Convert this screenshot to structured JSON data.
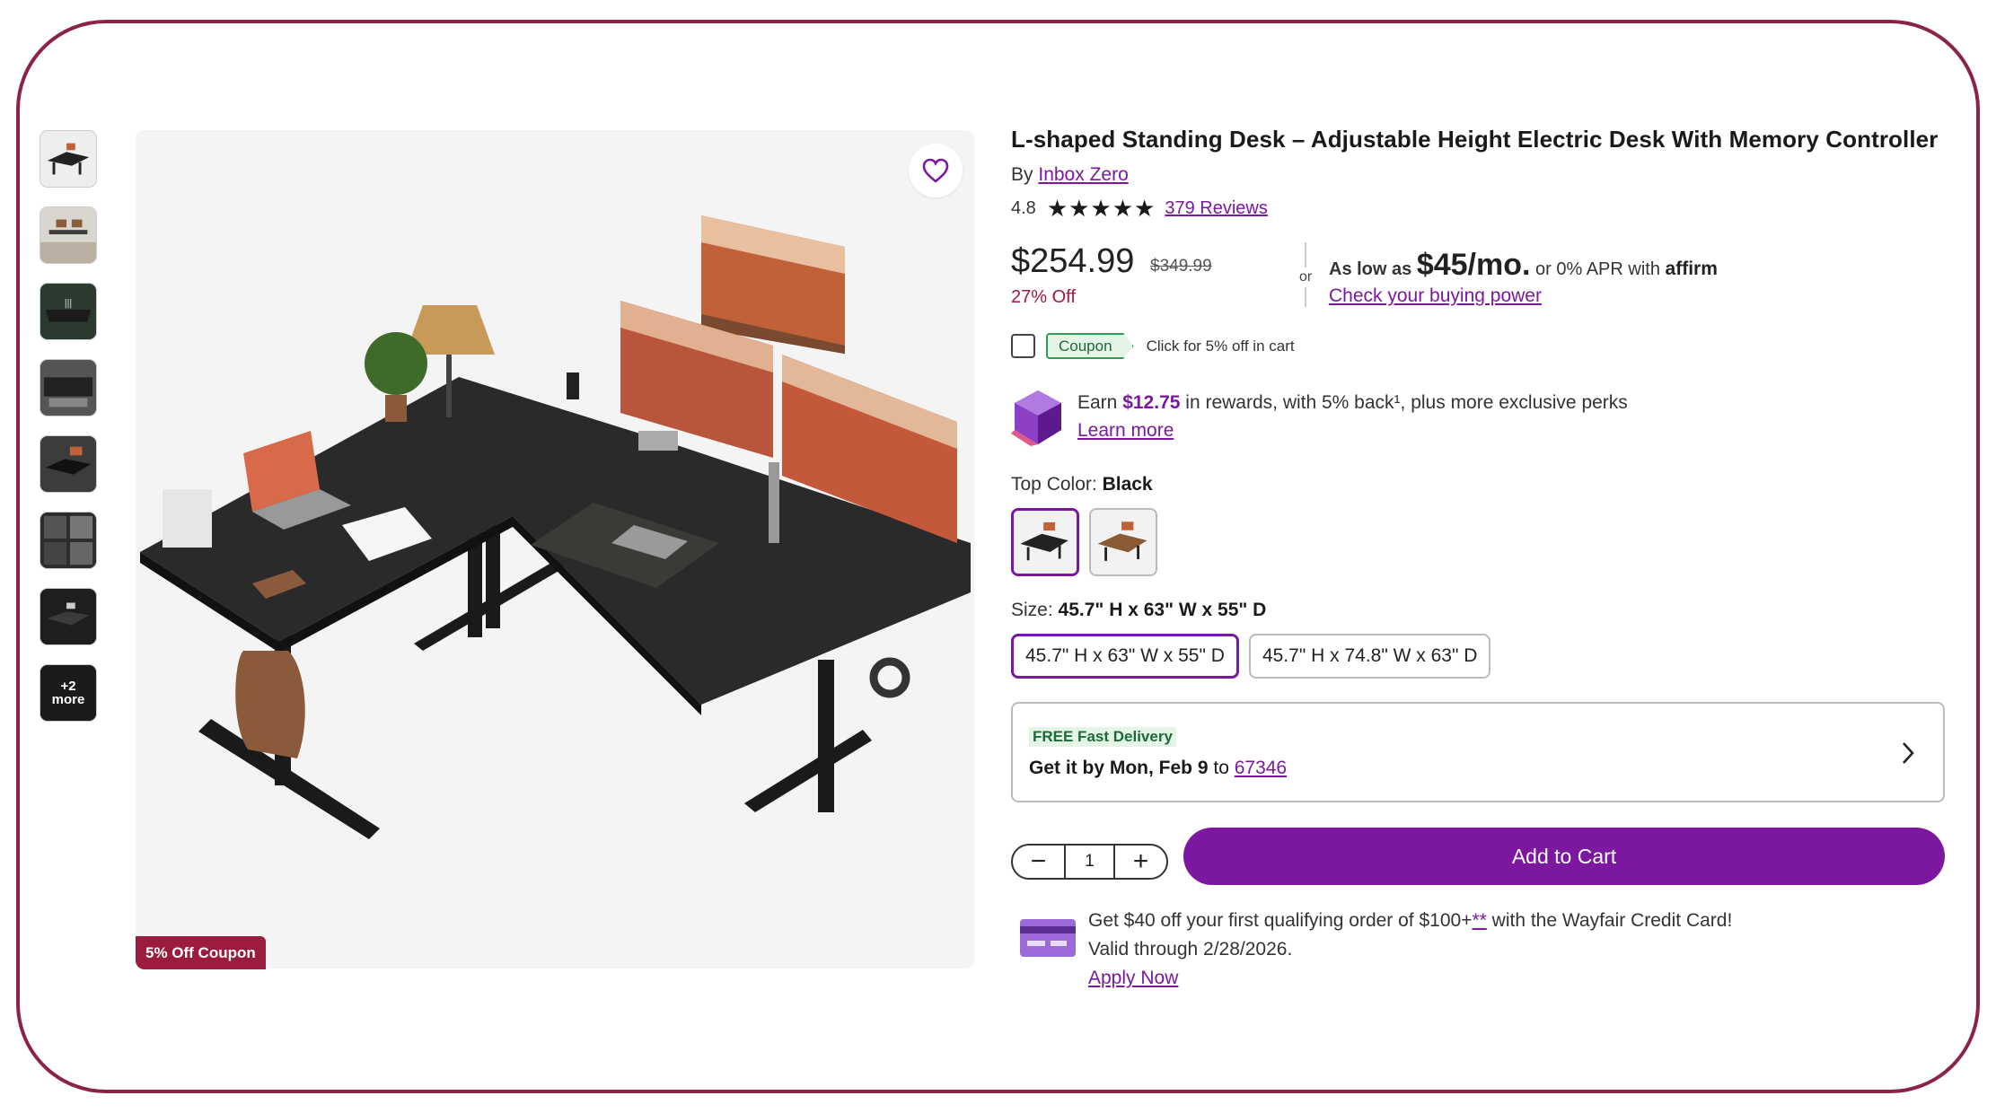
{
  "product": {
    "title": "L-shaped Standing Desk – Adjustable Height Electric Desk With Memory Controller",
    "by_prefix": "By",
    "brand": "Inbox Zero",
    "rating": "4.8",
    "stars": "★★★★★",
    "reviews": "379 Reviews"
  },
  "pricing": {
    "price": "$254.99",
    "was_price": "$349.99",
    "discount": "27% Off",
    "or": "or",
    "as_low_as": "As low as",
    "monthly": "$45/mo.",
    "apr": "or 0% APR with",
    "affirm": "affirm",
    "buying_power": "Check your buying power"
  },
  "coupon": {
    "tag": "Coupon",
    "note": "Click for 5% off in cart",
    "badge": "5% Off Coupon"
  },
  "rewards": {
    "earn": "Earn",
    "amount": "$12.75",
    "rest": "in rewards, with 5% back¹, plus more exclusive perks",
    "learn_more": "Learn more"
  },
  "options": {
    "color_label": "Top Color:",
    "color_value": "Black",
    "size_label": "Size:",
    "size_value": "45.7\" H x 63\" W x 55\" D",
    "sizes": [
      "45.7\" H x 63\" W x 55\" D",
      "45.7\" H x 74.8\" W x 63\" D"
    ]
  },
  "delivery": {
    "badge": "FREE Fast Delivery",
    "get_it": "Get it by Mon, Feb 9",
    "to": "to",
    "zip": "67346"
  },
  "cart": {
    "minus": "−",
    "qty": "1",
    "plus": "+",
    "add_label": "Add to Cart"
  },
  "credit": {
    "line1": "Get $40 off your first qualifying order of $100+",
    "footnote": "**",
    "line1b": " with the Wayfair Credit Card!",
    "line2": "Valid through 2/28/2026.",
    "apply": "Apply Now"
  },
  "gallery": {
    "more_count": "+2",
    "more_label": "more"
  },
  "colors": {
    "accent": "#7b189f",
    "sale": "#a1173a",
    "badge": "#9b1c3c",
    "frame": "#8a2345",
    "green": "#1c6b34"
  }
}
